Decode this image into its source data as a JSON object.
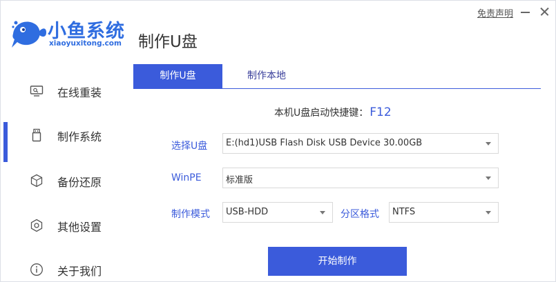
{
  "brand": {
    "name": "小鱼系统",
    "url": "xiaoyuxitong.com"
  },
  "app_title": "制作U盘",
  "titlebar": {
    "disclaimer": "免责声明"
  },
  "sidebar": {
    "items": [
      {
        "label": "在线重装",
        "icon": "monitor-icon"
      },
      {
        "label": "制作系统",
        "icon": "usb-drive-icon",
        "active": true
      },
      {
        "label": "备份还原",
        "icon": "cube-icon"
      },
      {
        "label": "其他设置",
        "icon": "gear-icon"
      },
      {
        "label": "关于我们",
        "icon": "info-icon"
      }
    ]
  },
  "tabs": [
    {
      "label": "制作U盘",
      "active": true
    },
    {
      "label": "制作本地",
      "active": false
    }
  ],
  "hotkey": {
    "label": "本机U盘启动快捷键：",
    "key": "F12"
  },
  "form": {
    "usb_label": "选择U盘",
    "usb_value": "E:(hd1)USB Flash Disk USB Device 30.00GB",
    "winpe_label": "WinPE",
    "winpe_value": "标准版",
    "mode_label": "制作模式",
    "mode_value": "USB-HDD",
    "partition_label": "分区格式",
    "partition_value": "NTFS"
  },
  "start_button": "开始制作",
  "colors": {
    "accent": "#3b5bdb",
    "brand": "#2f6de0"
  }
}
